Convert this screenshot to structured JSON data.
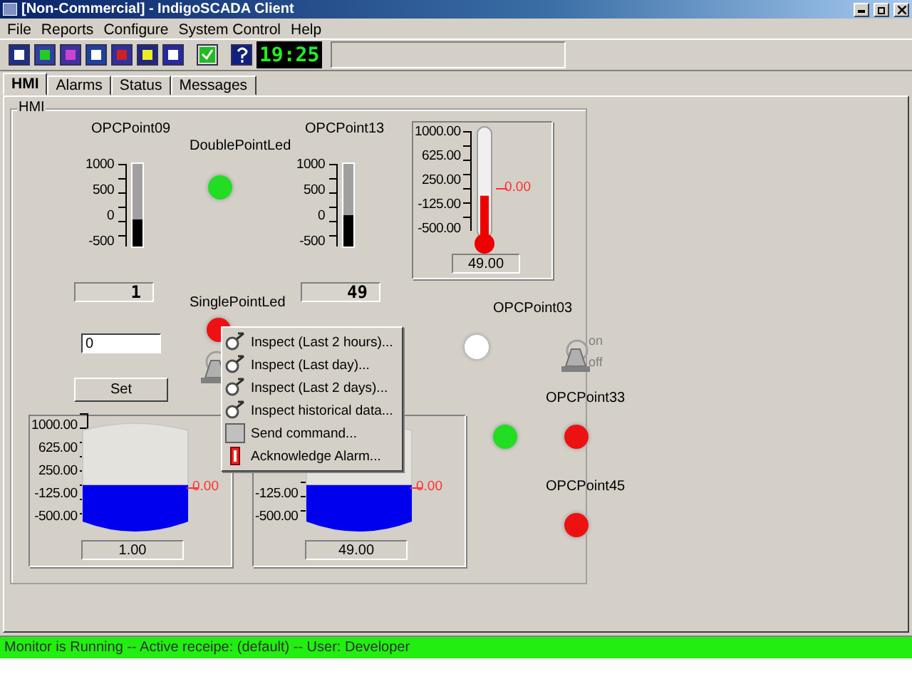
{
  "window": {
    "title": "[Non-Commercial] - IndigoSCADA Client"
  },
  "menu": [
    "File",
    "Reports",
    "Configure",
    "System Control",
    "Help"
  ],
  "toolbar": {
    "clock": "19:25"
  },
  "tabs": [
    {
      "label": "HMI",
      "selected": true
    },
    {
      "label": "Alarms",
      "selected": false
    },
    {
      "label": "Status",
      "selected": false
    },
    {
      "label": "Messages",
      "selected": false
    }
  ],
  "hmi": {
    "title": "HMI",
    "widgets": [
      {
        "kind": "label",
        "text": "OPCPoint09"
      },
      {
        "kind": "label",
        "text": "DoublePointLed"
      },
      {
        "kind": "label",
        "text": "OPCPoint13"
      },
      {
        "kind": "bar_gauge",
        "ticks": [
          "1000",
          "500",
          "0",
          "-500"
        ],
        "level": 0.33
      },
      {
        "kind": "led",
        "color": "#22dd22"
      },
      {
        "kind": "bar_gauge",
        "ticks": [
          "1000",
          "500",
          "0",
          "-500"
        ],
        "level": 0.38
      },
      {
        "kind": "thermometer",
        "ticks": [
          "1000.00",
          "625.00",
          "250.00",
          "-125.00",
          "-500.00"
        ],
        "level": 0.38,
        "marker": "0.00",
        "value": "49.00"
      },
      {
        "kind": "display",
        "value": "1"
      },
      {
        "kind": "display",
        "value": "49"
      },
      {
        "kind": "label",
        "text": "SinglePointLed"
      },
      {
        "kind": "led",
        "color": "#ee1111"
      },
      {
        "kind": "input",
        "value": "0"
      },
      {
        "kind": "button",
        "label": "Set"
      },
      {
        "kind": "switch"
      },
      {
        "kind": "tank",
        "ticks": [
          "1000.00",
          "625.00",
          "250.00",
          "-125.00",
          "-500.00"
        ],
        "level": 0.4,
        "marker": "0.00",
        "value": "1.00"
      },
      {
        "kind": "tank",
        "ticks": [
          "-125.00",
          "-500.00"
        ],
        "level": 0.4,
        "marker": "0.00",
        "value": "49.00"
      },
      {
        "kind": "label",
        "text": "OPCPoint03"
      },
      {
        "kind": "led",
        "color": "#ffffff"
      },
      {
        "kind": "switch",
        "on": "on",
        "off": "off"
      },
      {
        "kind": "label",
        "text": "OPCPoint33"
      },
      {
        "kind": "led",
        "color": "#22dd22"
      },
      {
        "kind": "led",
        "color": "#ee1111"
      },
      {
        "kind": "label",
        "text": "OPCPoint45"
      },
      {
        "kind": "led",
        "color": "#ee1111"
      }
    ]
  },
  "context_menu": {
    "items": [
      {
        "kind": "inspect",
        "label": "Inspect (Last 2 hours)..."
      },
      {
        "kind": "inspect",
        "label": "Inspect (Last day)..."
      },
      {
        "kind": "inspect",
        "label": "Inspect (Last 2 days)..."
      },
      {
        "kind": "inspect",
        "label": "Inspect historical data..."
      },
      {
        "kind": "command",
        "label": "Send command..."
      },
      {
        "kind": "alarm",
        "label": "Acknowledge Alarm..."
      }
    ]
  },
  "status_bar": "Monitor is Running -- Active receipe: (default) -- User: Developer"
}
